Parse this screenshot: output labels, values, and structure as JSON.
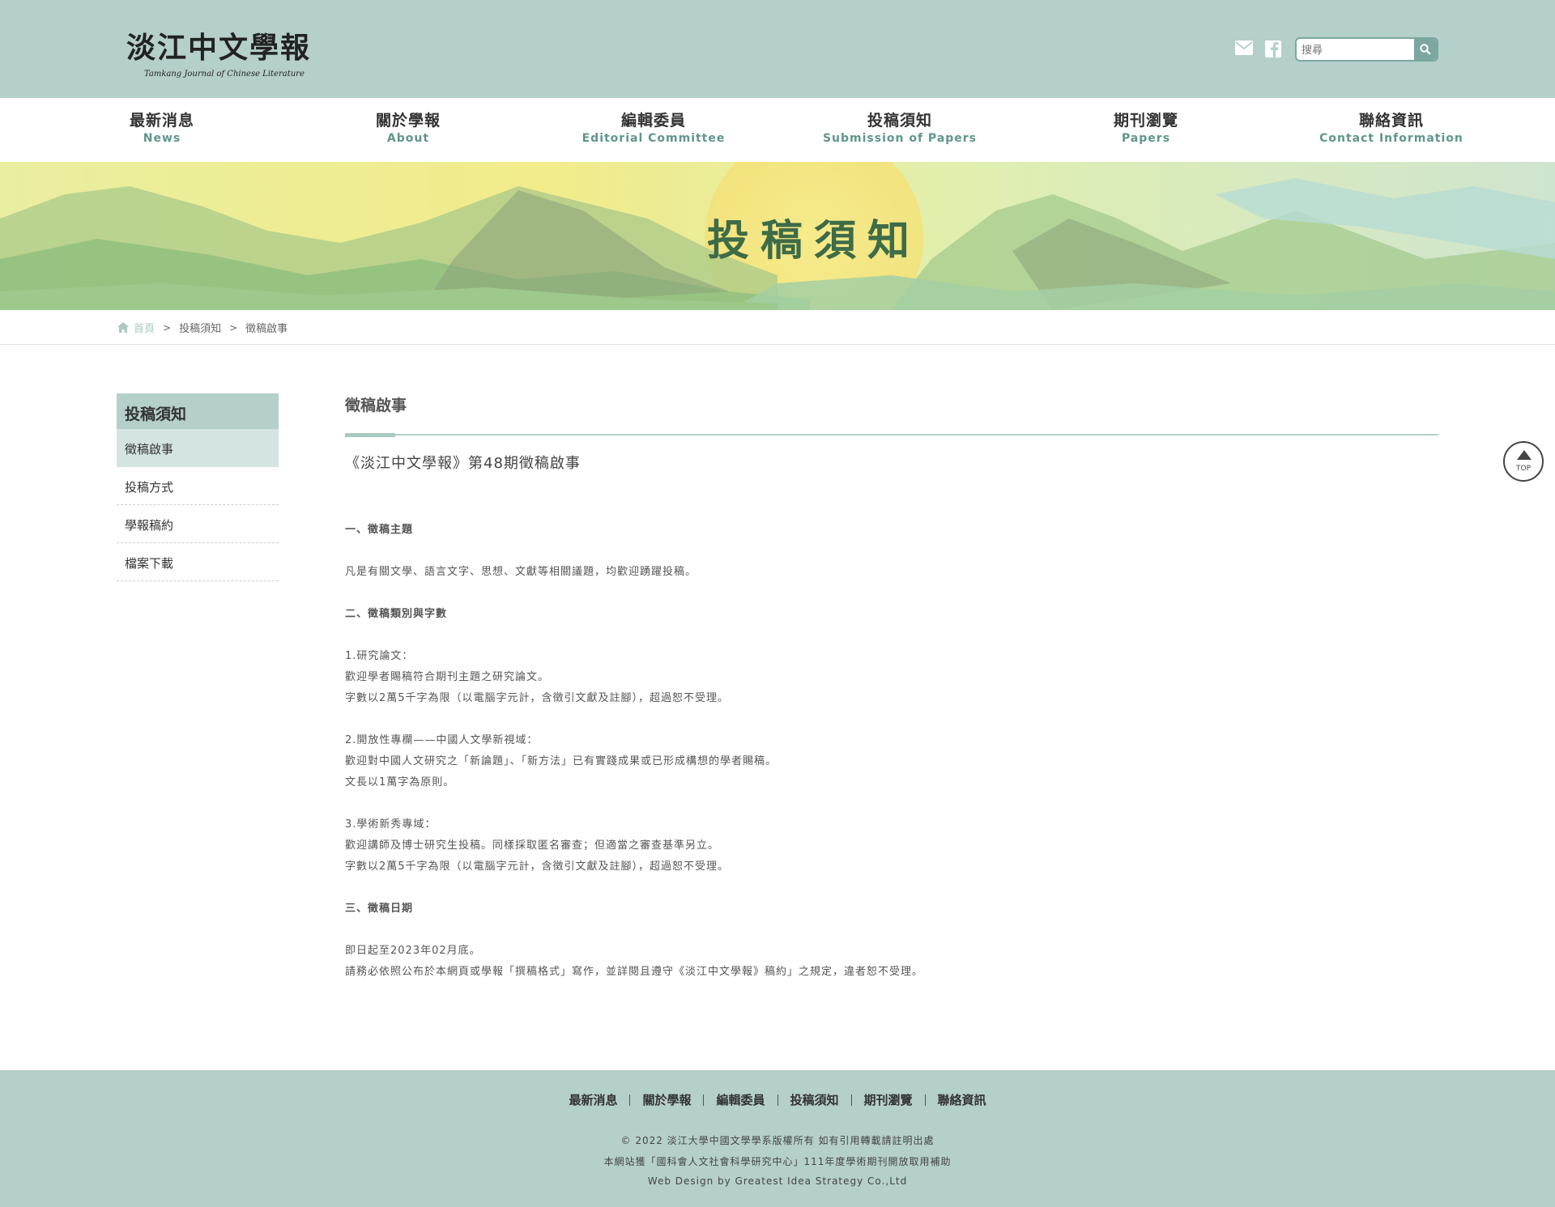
{
  "header": {
    "logo_cn": "淡江中文學報",
    "logo_en": "Tamkang Journal of Chinese Literature",
    "search_placeholder": "搜尋"
  },
  "nav": [
    {
      "cn": "最新消息",
      "en": "News"
    },
    {
      "cn": "關於學報",
      "en": "About"
    },
    {
      "cn": "編輯委員",
      "en": "Editorial Committee"
    },
    {
      "cn": "投稿須知",
      "en": "Submission of Papers"
    },
    {
      "cn": "期刊瀏覽",
      "en": "Papers"
    },
    {
      "cn": "聯絡資訊",
      "en": "Contact Information"
    }
  ],
  "banner": {
    "title": "投稿須知"
  },
  "breadcrumb": [
    "首頁",
    "投稿須知",
    "徵稿啟事"
  ],
  "sidebar": {
    "title": "投稿須知",
    "items": [
      "徵稿啟事",
      "投稿方式",
      "學報稿約",
      "檔案下載"
    ]
  },
  "main": {
    "page_title": "徵稿啟事",
    "issue_title": "《淡江中文學報》第48期徵稿啟事",
    "s1_head": "一、徵稿主題",
    "s1_l1": "凡是有關文學、語言文字、思想、文獻等相關議題，均歡迎踴躍投稿。",
    "s2_head": "二、徵稿類別與字數",
    "s2a_h": "1.研究論文：",
    "s2a_l1": "歡迎學者賜稿符合期刊主題之研究論文。",
    "s2a_l2": "字數以2萬5千字為限（以電腦字元計，含徵引文獻及註腳），超過恕不受理。",
    "s2b_h": "2.開放性專欄——中國人文學新視域：",
    "s2b_l1": "歡迎對中國人文研究之「新論題」、「新方法」已有實踐成果或已形成構想的學者賜稿。",
    "s2b_l2": "文長以1萬字為原則。",
    "s2c_h": "3.學術新秀專域：",
    "s2c_l1": "歡迎講師及博士研究生投稿。同樣採取匿名審查；但適當之審查基準另立。",
    "s2c_l2": "字數以2萬5千字為限（以電腦字元計，含徵引文獻及註腳），超過恕不受理。",
    "s3_head": "三、徵稿日期",
    "s3_l1": "即日起至2023年02月底。",
    "s3_l2": "請務必依照公布於本網頁或學報「撰稿格式」寫作，並詳閱且遵守《淡江中文學報》稿約」之規定，違者恕不受理。"
  },
  "top_button": "TOP",
  "footer": {
    "links": [
      "最新消息",
      "關於學報",
      "編輯委員",
      "投稿須知",
      "期刊瀏覽",
      "聯絡資訊"
    ],
    "copyright": "© 2022 淡江大學中國文學學系版權所有 如有引用轉載請註明出處",
    "grant": "本網站獲「國科會人文社會科學研究中心」111年度學術期刊開放取用補助",
    "credit": "Web Design by Greatest Idea Strategy Co.,Ltd"
  },
  "colors": {
    "header_bg": "#b5cfcb",
    "accent": "#7ba7a0",
    "nav_en": "#5f958c",
    "banner_title": "#3e6b48"
  }
}
